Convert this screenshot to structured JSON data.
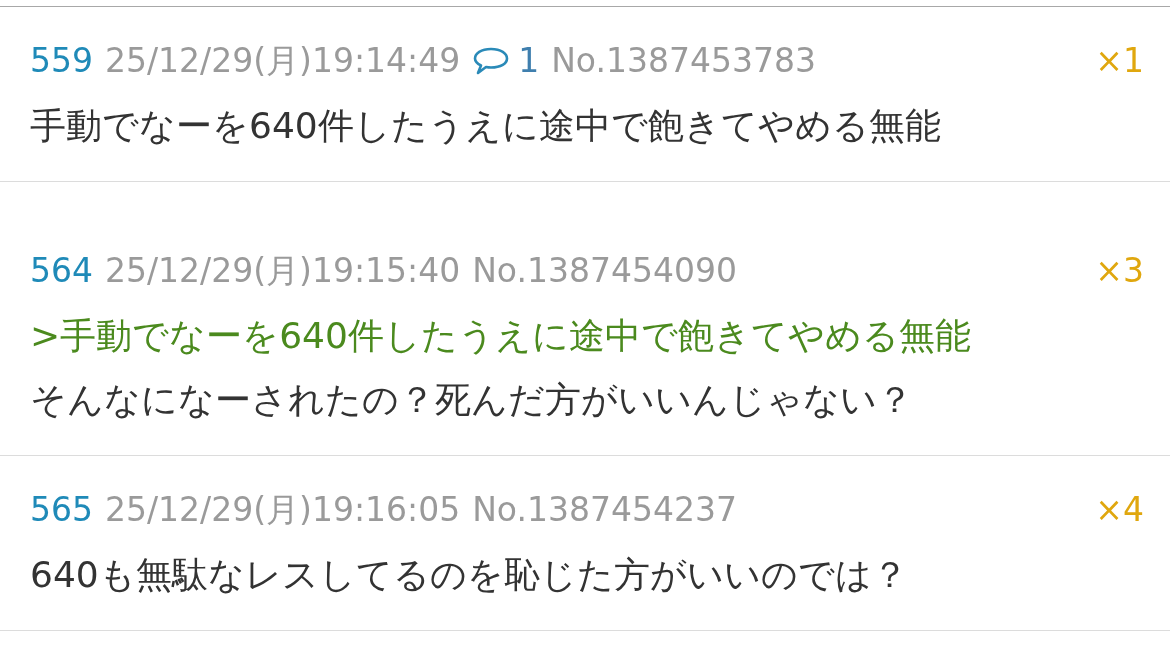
{
  "posts": [
    {
      "number": "559",
      "date": "25/12/29(月)19:14:49",
      "replies": "1",
      "post_no": "No.1387453783",
      "count": "×1",
      "lines": [
        {
          "kind": "plain",
          "text": "手動でなーを640件したうえに途中で飽きてやめる無能"
        }
      ]
    },
    {
      "number": "564",
      "date": "25/12/29(月)19:15:40",
      "post_no": "No.1387454090",
      "count": "×3",
      "lines": [
        {
          "kind": "quote",
          "text": ">手動でなーを640件したうえに途中で飽きてやめる無能"
        },
        {
          "kind": "plain",
          "text": "そんなになーされたの？死んだ方がいいんじゃない？"
        }
      ]
    },
    {
      "number": "565",
      "date": "25/12/29(月)19:16:05",
      "post_no": "No.1387454237",
      "count": "×4",
      "lines": [
        {
          "kind": "plain",
          "text": "640も無駄なレスしてるのを恥じた方がいいのでは？"
        }
      ]
    }
  ]
}
